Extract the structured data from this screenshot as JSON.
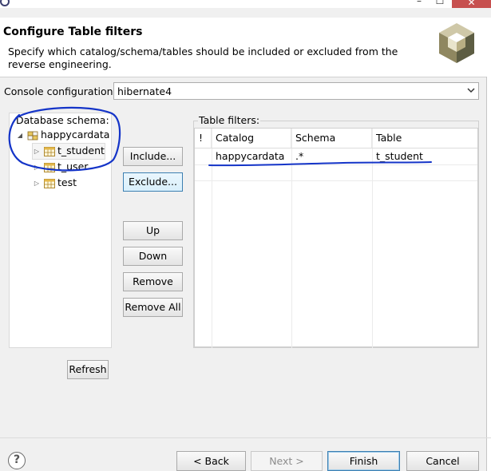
{
  "window": {
    "minimize_glyph": "–",
    "maximize_glyph": "☐",
    "close_glyph": "✕"
  },
  "header": {
    "title": "Configure Table filters",
    "description": "Specify which catalog/schema/tables should be included or excluded from the reverse engineering."
  },
  "console": {
    "label": "Console configuration:",
    "value": "hibernate4"
  },
  "tree": {
    "label": "Database schema:",
    "root": {
      "label": "happycardata"
    },
    "items": [
      {
        "label": "t_student"
      },
      {
        "label": "t_user"
      },
      {
        "label": "test"
      }
    ]
  },
  "actions": {
    "include": "Include...",
    "exclude": "Exclude...",
    "up": "Up",
    "down": "Down",
    "remove": "Remove",
    "remove_all": "Remove All",
    "refresh": "Refresh"
  },
  "filters": {
    "label": "Table filters:",
    "columns": [
      "!",
      "Catalog",
      "Schema",
      "Table"
    ],
    "rows": [
      {
        "flag": "",
        "catalog": "happycardata",
        "schema": ".*",
        "table": "t_student"
      }
    ]
  },
  "footer": {
    "help": "?",
    "back": "< Back",
    "next": "Next >",
    "finish": "Finish",
    "cancel": "Cancel"
  },
  "colors": {
    "annotation_ink": "#1434c8",
    "focus_border": "#3c7fb1"
  }
}
